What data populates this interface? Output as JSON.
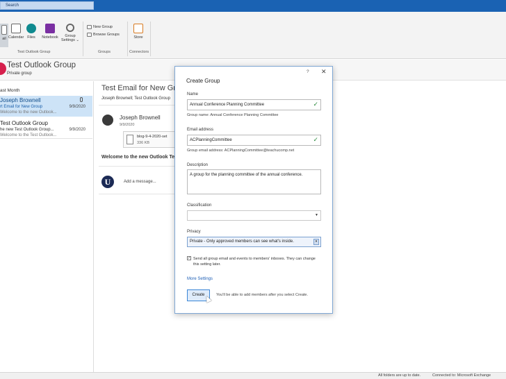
{
  "search": {
    "placeholder": "Search"
  },
  "ribbon": {
    "buttons": [
      {
        "label": "ail",
        "icon": "mail-icon"
      },
      {
        "label": "Calendar",
        "icon": "calendar-icon"
      },
      {
        "label": "Files",
        "icon": "sharepoint-icon"
      },
      {
        "label": "Notebook",
        "icon": "onenote-icon"
      },
      {
        "label": "Group",
        "label2": "Settings ⌄",
        "icon": "gear-icon"
      }
    ],
    "groups_items": [
      "New Group",
      "Browse Groups"
    ],
    "store_label": "Store",
    "group_labels": [
      "Test Outlook Group",
      "Groups",
      "Connectors"
    ]
  },
  "group_header": {
    "title": "Test Outlook Group",
    "subtitle": "Private group"
  },
  "list": {
    "section": "ast Month",
    "items": [
      {
        "from": "Joseph Brownell",
        "subject": "rt Email for New Group",
        "preview": "Welcome to the new Outlook...",
        "date": "9/9/2020",
        "selected": true
      },
      {
        "from": "Test Outlook Group",
        "subject": "he new Test Outlook Group...",
        "preview": "Welcome to the Test Outlook...",
        "date": "9/9/2020",
        "selected": false
      }
    ]
  },
  "reading": {
    "title": "Test Email for New Grou",
    "to": "Joseph Brownell; Test Outlook Group",
    "sender": "Joseph Brownell",
    "sent_date": "9/9/2020",
    "attachment": {
      "name": "blog-9-4-2020-set",
      "size": "336 KB"
    },
    "welcome": "Welcome to the new Outlook Test",
    "avatar_letter": "U",
    "add_message": "Add a message..."
  },
  "dialog": {
    "help": "?",
    "close": "✕",
    "title": "Create Group",
    "name_label": "Name",
    "name_value": "Annual Conference Planning Committee",
    "group_name_hint": "Group name: Annual Conference Planning Committee",
    "email_label": "Email address",
    "email_value": "ACPlanningCommittee",
    "email_hint": "Group email address: ACPlanningCommittee@teachucomp.net",
    "desc_label": "Description",
    "desc_value": "A group for the planning committee of the annual conference.",
    "class_label": "Classification",
    "class_value": "",
    "privacy_label": "Privacy",
    "privacy_value": "Private - Only approved members can see what's inside.",
    "send_all_checked": true,
    "send_all_text": "Send all group email and events to members' inboxes. They can change this setting later.",
    "more_settings": "More Settings",
    "create_button": "Create",
    "create_hint": "You'll be able to add members after you select Create."
  },
  "status": {
    "left": "All folders are up to date.",
    "right": "Connected to: Microsoft Exchange"
  },
  "colors": {
    "titlebar": "#1a62b3",
    "group_avatar": "#d6204d",
    "selected_item": "#cde3f7",
    "dialog_border": "#7fa7d4",
    "link": "#1e5fb5"
  }
}
